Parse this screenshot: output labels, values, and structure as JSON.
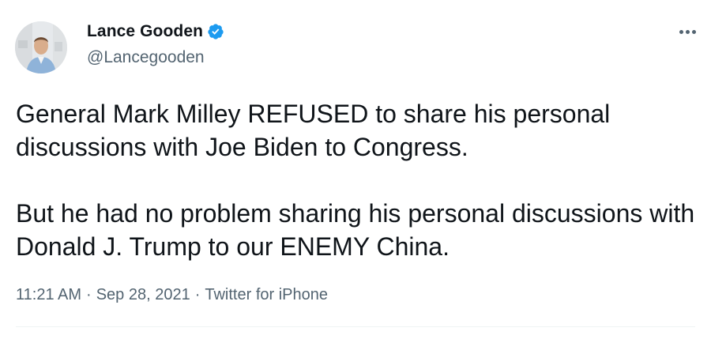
{
  "author": {
    "display_name": "Lance Gooden",
    "handle": "@Lancegooden",
    "verified": true
  },
  "tweet": {
    "paragraphs": [
      "General Mark Milley REFUSED to share his personal discussions with Joe Biden to Congress.",
      "But he had no problem sharing his personal discussions with Donald J. Trump to our ENEMY China."
    ],
    "time": "11:21 AM",
    "separator": "·",
    "date": "Sep 28, 2021",
    "source": "Twitter for iPhone"
  },
  "icons": {
    "verified": "verified-badge-icon",
    "more": "more-horizontal-icon"
  },
  "colors": {
    "text_primary": "#0f1419",
    "text_secondary": "#536471",
    "verified_blue": "#1d9bf0",
    "divider": "#eff3f4"
  }
}
